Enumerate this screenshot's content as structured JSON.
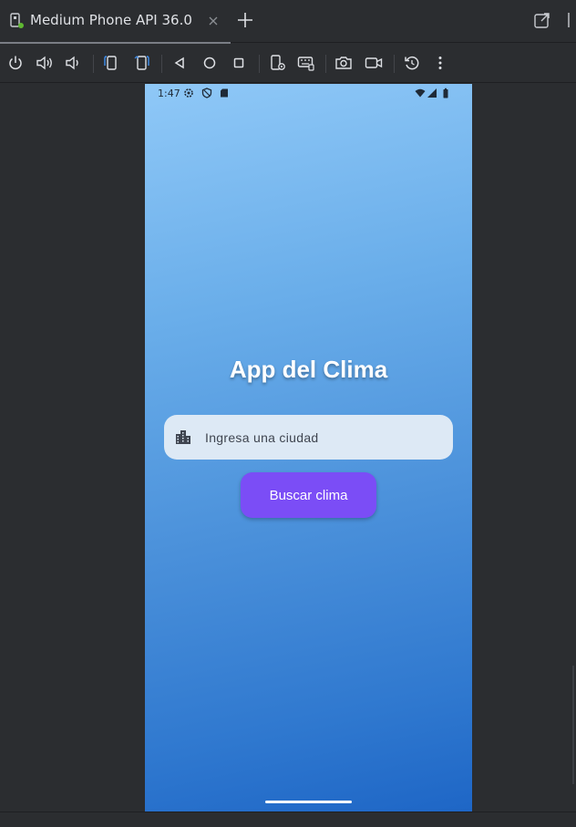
{
  "tab": {
    "title": "Medium Phone API 36.0",
    "icon": "device-icon",
    "close_icon": "close-icon",
    "add_icon": "plus-icon"
  },
  "toolbar": {
    "items": [
      "power-icon",
      "volume-up-icon",
      "volume-down-icon",
      "rotate-left-icon",
      "rotate-right-icon",
      "back-icon",
      "home-icon",
      "overview-icon",
      "device-settings-icon",
      "keyboard-icon",
      "screenshot-icon",
      "screen-record-icon",
      "reset-icon",
      "more-icon"
    ]
  },
  "phone": {
    "status": {
      "time": "1:47"
    },
    "title": "App del Clima",
    "search": {
      "placeholder": "Ingresa una ciudad",
      "value": ""
    },
    "button_label": "Buscar clima"
  },
  "colors": {
    "gradient_top": "#8fc8f7",
    "gradient_bottom": "#1e66c6",
    "button": "#7b4df6",
    "field": "#dde9f5",
    "ide_background": "#2b2d30"
  }
}
